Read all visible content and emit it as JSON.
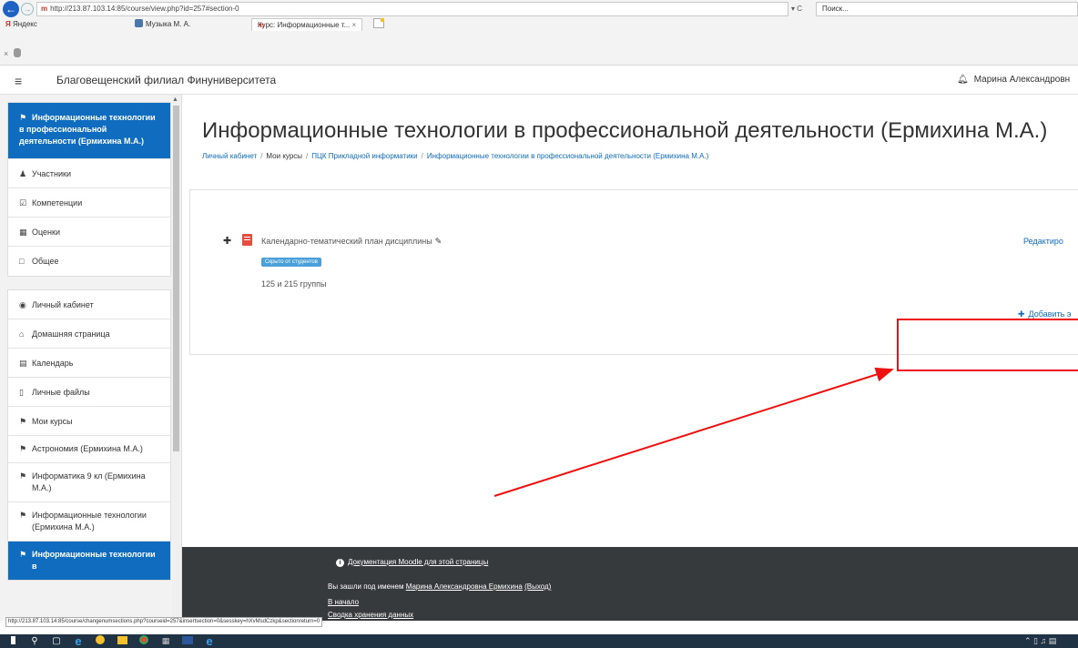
{
  "browser": {
    "url": "http://213.87.103.14:85/course/view.php?id=257#section-0",
    "search_placeholder": "Поиск...",
    "refresh_label": "▾ C",
    "favorites": {
      "yandex_letter": "Я",
      "yandex_label": "Яндекс",
      "music_label": "Музыка М. А."
    },
    "active_tab": "Курс: Информационные т...",
    "active_tab_close": "×",
    "row2_close": "×"
  },
  "navbar": {
    "hamburger": "≡",
    "site_name": "Благовещенский филиал Финуниверситета",
    "user_name": "Марина Александровн"
  },
  "drawer": {
    "course_active": "Информационные технологии в профессиональной деятельности (Ермихина М.А.)",
    "course_items": [
      {
        "label": "Участники"
      },
      {
        "label": "Компетенции"
      },
      {
        "label": "Оценки"
      },
      {
        "label": "Общее"
      }
    ],
    "site_items": [
      {
        "label": "Личный кабинет"
      },
      {
        "label": "Домашняя страница"
      },
      {
        "label": "Календарь"
      },
      {
        "label": "Личные файлы"
      },
      {
        "label": "Мои курсы"
      }
    ],
    "my_courses": [
      {
        "label": "Астрономия (Ермихина М.А.)"
      },
      {
        "label": "Информатика 9 кл (Ермихина М.А.)"
      },
      {
        "label": "Информационные технологии (Ермихина М.А.)"
      }
    ],
    "current_course": "Информационные технологии в"
  },
  "page": {
    "title": "Информационные технологии в профессиональной деятельности (Ермихина М.А.)",
    "breadcrumb": {
      "home": "Личный кабинет",
      "mycourses": "Мои курсы",
      "category": "ПЦК Прикладной информатики",
      "course": "Информационные технологии в профессиональной деятельности (Ермихина М.А.)",
      "separator": "/"
    },
    "activity": {
      "name": "Календарно-тематический план дисциплины",
      "badge": "Скрыто от студентов",
      "availability": "125 и 215 группы"
    },
    "edit_label": "Редактиро",
    "add_label": "Добавить э"
  },
  "footer": {
    "docs": "Документация Moodle для этой страницы",
    "login_prefix": "Вы зашли под именем",
    "login_user": "Марина Александровна Ермихина",
    "logout": "(Выход)",
    "home": "В начало",
    "data": "Сводка хранения данных"
  },
  "status_url": "http://213.87.103.14:85/course/changenumsections.php?courseid=257&insertsection=0&sesskey=hXvMsdCzkp&sectionreturn=0",
  "colors": {
    "brand_blue": "#0f6cbf",
    "footer_bg": "#373a3c",
    "annotation_red": "#ee1111",
    "badge_blue": "#4aa0d8"
  }
}
